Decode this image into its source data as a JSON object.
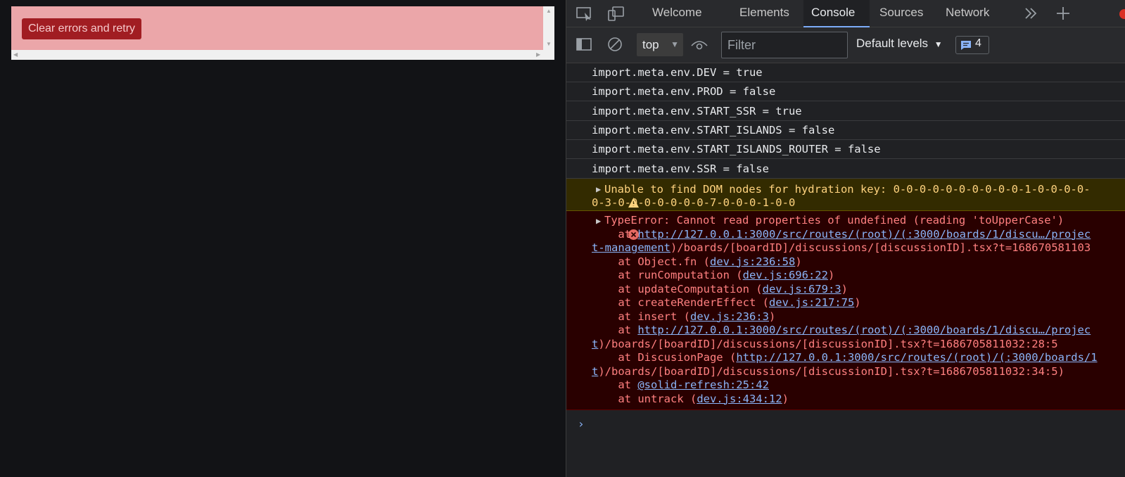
{
  "page": {
    "retry_button": "Clear errors and retry"
  },
  "devtools": {
    "tabs": [
      {
        "label": "Welcome",
        "active": false
      },
      {
        "label": "Elements",
        "active": false
      },
      {
        "label": "Console",
        "active": true
      },
      {
        "label": "Sources",
        "active": false
      },
      {
        "label": "Network",
        "active": false
      }
    ],
    "toolbar": {
      "context": "top",
      "filter_placeholder": "Filter",
      "levels": "Default levels",
      "message_count": "4"
    },
    "logs": [
      "import.meta.env.DEV = true",
      "import.meta.env.PROD = false",
      "import.meta.env.START_SSR = true",
      "import.meta.env.START_ISLANDS = false",
      "import.meta.env.START_ISLANDS_ROUTER = false",
      "import.meta.env.SSR = false"
    ],
    "warning": {
      "line1": "Unable to find DOM nodes for hydration key: 0-0-0-0-0-0-0-0-0-0-1-0-0-0-0-",
      "line2": "0-3-0-0-0-0-0-0-0-7-0-0-0-1-0-0"
    },
    "error": {
      "title": "TypeError: Cannot read properties of undefined (reading 'toUpperCase')",
      "frames": [
        {
          "prefix": "    at ",
          "link": "http://127.0.0.1:3000/src/routes/(root)/(:3000/boards/1/discu…/projec",
          "suffix": ""
        },
        {
          "prefix": "",
          "link": "t-management",
          "suffix": ")/boards/[boardID]/discussions/[discussionID].tsx?t=168670581103"
        },
        {
          "prefix": "    at Object.fn (",
          "link": "dev.js:236:58",
          "suffix": ")"
        },
        {
          "prefix": "    at runComputation (",
          "link": "dev.js:696:22",
          "suffix": ")"
        },
        {
          "prefix": "    at updateComputation (",
          "link": "dev.js:679:3",
          "suffix": ")"
        },
        {
          "prefix": "    at createRenderEffect (",
          "link": "dev.js:217:75",
          "suffix": ")"
        },
        {
          "prefix": "    at insert (",
          "link": "dev.js:236:3",
          "suffix": ")"
        },
        {
          "prefix": "    at ",
          "link": "http://127.0.0.1:3000/src/routes/(root)/(:3000/boards/1/discu…/projec",
          "suffix": ""
        },
        {
          "prefix": "",
          "link": "t",
          "suffix": ")/boards/[boardID]/discussions/[discussionID].tsx?t=1686705811032:28:5"
        },
        {
          "prefix": "    at DiscusionPage (",
          "link": "http://127.0.0.1:3000/src/routes/(root)/(:3000/boards/1",
          "suffix": ""
        },
        {
          "prefix": "",
          "link": "t",
          "suffix": ")/boards/[boardID]/discussions/[discussionID].tsx?t=1686705811032:34:5)"
        },
        {
          "prefix": "    at ",
          "link": "@solid-refresh:25:42",
          "suffix": ""
        },
        {
          "prefix": "    at untrack (",
          "link": "dev.js:434:12",
          "suffix": ")"
        }
      ]
    }
  }
}
